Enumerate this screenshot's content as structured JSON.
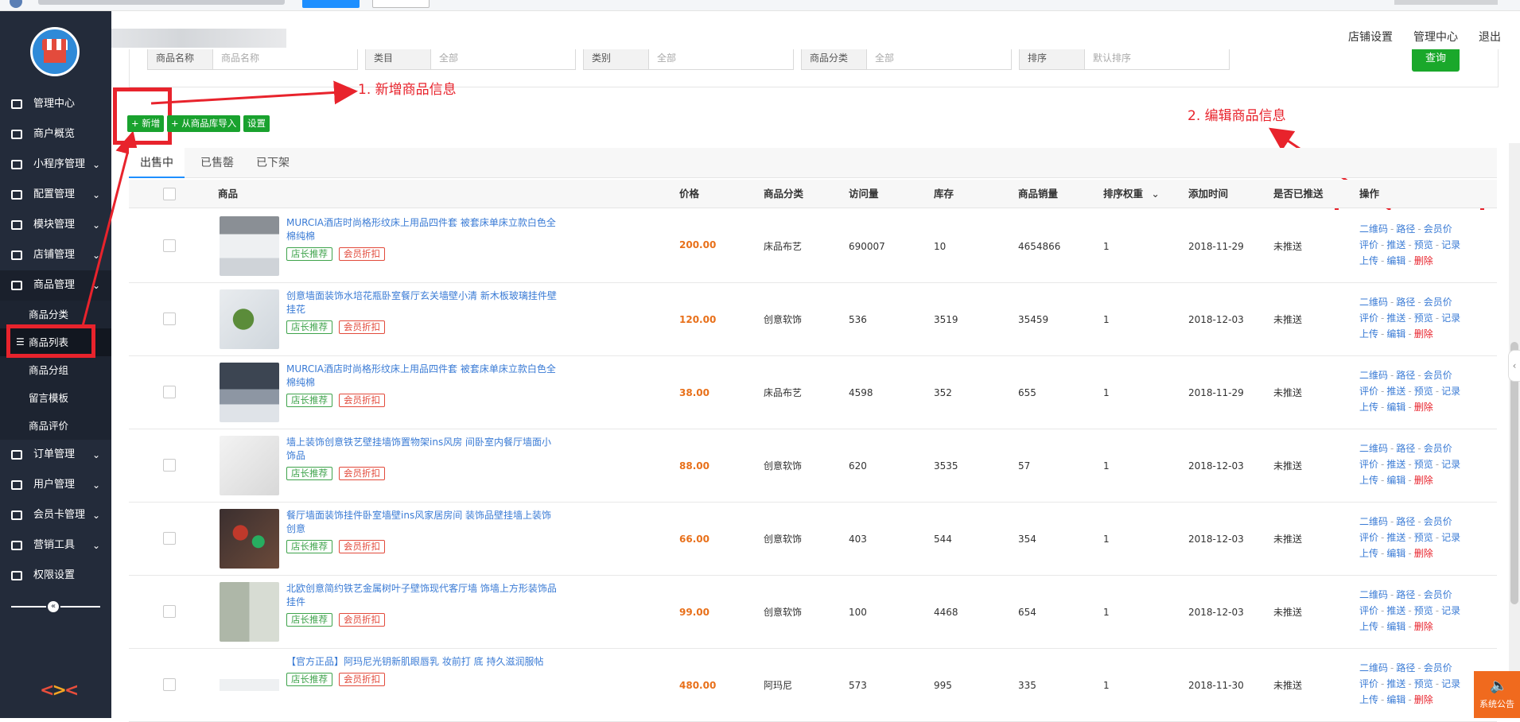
{
  "header": {
    "links": [
      "店铺设置",
      "管理中心",
      "退出"
    ]
  },
  "sidebar": {
    "items": [
      {
        "label": "管理中心",
        "chevron": false
      },
      {
        "label": "商户概览",
        "chevron": false
      },
      {
        "label": "小程序管理",
        "chevron": true
      },
      {
        "label": "配置管理",
        "chevron": true
      },
      {
        "label": "模块管理",
        "chevron": true
      },
      {
        "label": "店铺管理",
        "chevron": true
      },
      {
        "label": "商品管理",
        "chevron": true
      }
    ],
    "sub_items": [
      "商品分类",
      "商品列表",
      "商品分组",
      "留言模板",
      "商品评价"
    ],
    "items_after": [
      {
        "label": "订单管理",
        "chevron": true
      },
      {
        "label": "用户管理",
        "chevron": true
      },
      {
        "label": "会员卡管理",
        "chevron": true
      },
      {
        "label": "营销工具",
        "chevron": true
      },
      {
        "label": "权限设置",
        "chevron": false
      }
    ]
  },
  "filters": {
    "fields": [
      {
        "label": "商品名称",
        "value": "商品名称"
      },
      {
        "label": "类目",
        "value": "全部"
      },
      {
        "label": "类别",
        "value": "全部"
      },
      {
        "label": "商品分类",
        "value": "全部"
      },
      {
        "label": "排序",
        "value": "默认排序"
      }
    ],
    "search_button": "查询"
  },
  "annotations": {
    "add_note": "1.  新增商品信息",
    "edit_note": "2.  编辑商品信息"
  },
  "actions": {
    "add": "新增",
    "import": "从商品库导入",
    "settings": "设置"
  },
  "tabs": [
    "出售中",
    "已售罄",
    "已下架"
  ],
  "table": {
    "headers": [
      "商品",
      "价格",
      "商品分类",
      "访问量",
      "库存",
      "商品销量",
      "排序权重",
      "添加时间",
      "是否已推送",
      "操作"
    ],
    "tags": [
      "店长推荐",
      "会员折扣"
    ],
    "ops": [
      "二维码",
      "路径",
      "会员价",
      "评价",
      "推送",
      "预览",
      "记录",
      "上传",
      "编辑",
      "删除"
    ],
    "rows": [
      {
        "title": "MURCIA酒店时尚格形纹床上用品四件套 被套床单床立款白色全棉纯棉",
        "price": "200.00",
        "category": "床品布艺",
        "visits": "690007",
        "stock": "10",
        "sales": "4654866",
        "weight": "1",
        "date": "2018-11-29",
        "pushed": "未推送",
        "thumb": "bed"
      },
      {
        "title": "创意墙面装饰水培花瓶卧室餐厅玄关墙壁小清 新木板玻璃挂件壁挂花",
        "price": "120.00",
        "category": "创意软饰",
        "visits": "536",
        "stock": "3519",
        "sales": "35459",
        "weight": "1",
        "date": "2018-12-03",
        "pushed": "未推送",
        "thumb": "plant"
      },
      {
        "title": "MURCIA酒店时尚格形纹床上用品四件套 被套床单床立款白色全棉纯棉",
        "price": "38.00",
        "category": "床品布艺",
        "visits": "4598",
        "stock": "352",
        "sales": "655",
        "weight": "1",
        "date": "2018-11-29",
        "pushed": "未推送",
        "thumb": "pillow"
      },
      {
        "title": "墙上装饰创意铁艺壁挂墙饰置物架ins风房 间卧室内餐厅墙面小饰品",
        "price": "88.00",
        "category": "创意软饰",
        "visits": "620",
        "stock": "3535",
        "sales": "57",
        "weight": "1",
        "date": "2018-12-03",
        "pushed": "未推送",
        "thumb": "shelf"
      },
      {
        "title": "餐厅墙面装饰挂件卧室墙壁ins风家居房间 装饰品壁挂墙上装饰创意",
        "price": "66.00",
        "category": "创意软饰",
        "visits": "403",
        "stock": "544",
        "sales": "354",
        "weight": "1",
        "date": "2018-12-03",
        "pushed": "未推送",
        "thumb": "flower"
      },
      {
        "title": "北欧创意简约铁艺金属树叶子壁饰现代客厅墙 饰墙上方形装饰品挂件",
        "price": "99.00",
        "category": "创意软饰",
        "visits": "100",
        "stock": "4468",
        "sales": "654",
        "weight": "1",
        "date": "2018-12-03",
        "pushed": "未推送",
        "thumb": "frame"
      },
      {
        "title": "【官方正品】阿玛尼光钥新肌眼唇乳 妆前打 底 持久滋润服帖",
        "price": "480.00",
        "category": "阿玛尼",
        "visits": "573",
        "stock": "995",
        "sales": "335",
        "weight": "1",
        "date": "2018-11-30",
        "pushed": "未推送",
        "thumb": "cosmetic"
      }
    ]
  },
  "widgets": {
    "notice": "系统公告"
  }
}
